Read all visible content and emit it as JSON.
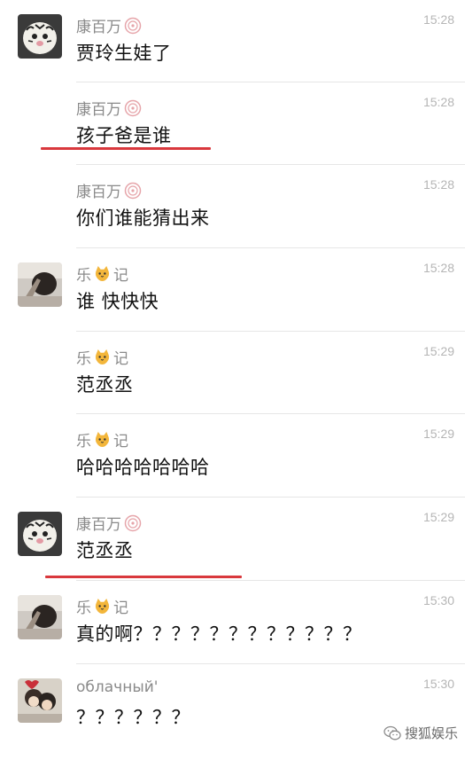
{
  "messages": [
    {
      "sender": "康百万",
      "avatar": "tiger-avatar",
      "time": "15:28",
      "text": "贾玲生娃了",
      "show_avatar": true
    },
    {
      "sender": "康百万",
      "avatar": "tiger-avatar",
      "time": "15:28",
      "text": "孩子爸是谁",
      "show_avatar": false
    },
    {
      "sender": "康百万",
      "avatar": "tiger-avatar",
      "time": "15:28",
      "text": "你们谁能猜出来",
      "show_avatar": false
    },
    {
      "sender": "乐",
      "sender_suffix": "记",
      "avatar": "person-avatar",
      "time": "15:28",
      "text": "谁 快快快",
      "show_avatar": true
    },
    {
      "sender": "乐",
      "sender_suffix": "记",
      "avatar": "person-avatar",
      "time": "15:29",
      "text": "范丞丞",
      "show_avatar": false
    },
    {
      "sender": "乐",
      "sender_suffix": "记",
      "avatar": "person-avatar",
      "time": "15:29",
      "text": "哈哈哈哈哈哈哈",
      "show_avatar": false
    },
    {
      "sender": "康百万",
      "avatar": "tiger-avatar",
      "time": "15:29",
      "text": "范丞丞",
      "show_avatar": true
    },
    {
      "sender": "乐",
      "sender_suffix": "记",
      "avatar": "person-avatar",
      "time": "15:30",
      "text": "真的啊？？？？？？？？？？？？",
      "show_avatar": true
    },
    {
      "sender": "облачный'",
      "avatar": "anime-avatar",
      "time": "15:30",
      "text": "？？？？？？",
      "show_avatar": true
    }
  ],
  "watermark": "搜狐娱乐",
  "colors": {
    "highlight_underline": "#d9383d",
    "timestamp": "#b5b5b5",
    "sender": "#8a8a8a"
  }
}
